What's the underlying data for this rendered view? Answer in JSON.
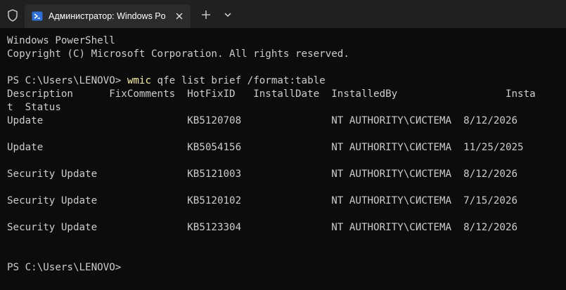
{
  "tab": {
    "title": "Администратор: Windows Po",
    "close_icon": "close-icon",
    "app_icon": "powershell-icon"
  },
  "toolbar": {
    "shield_icon": "shield-icon",
    "new_tab_icon": "plus-icon",
    "dropdown_icon": "chevron-down-icon"
  },
  "terminal": {
    "header_line1": "Windows PowerShell",
    "header_line2": "Copyright (C) Microsoft Corporation. All rights reserved.",
    "prompt": "PS C:\\Users\\LENOVO> ",
    "command_keyword": "wmic",
    "command_rest": " qfe list brief /format:table",
    "table_header_line1": "Description      FixComments  HotFixID   InstallDate  InstalledBy                  Insta",
    "table_header_line2": "t  Status",
    "rows": [
      "Update                        KB5120708               NT AUTHORITY\\СИСТЕМА  8/12/2026",
      "Update                        KB5054156               NT AUTHORITY\\СИСТЕМА  11/25/2025",
      "Security Update               KB5121003               NT AUTHORITY\\СИСТЕМА  8/12/2026",
      "Security Update               KB5120102               NT AUTHORITY\\СИСТЕМА  7/15/2026",
      "Security Update               KB5123304               NT AUTHORITY\\СИСТЕМА  8/12/2026"
    ],
    "final_prompt": "PS C:\\Users\\LENOVO>"
  },
  "colors": {
    "background": "#0c0c0c",
    "tabbar": "#202020",
    "tab_active": "#2b2b2b",
    "text": "#cccccc",
    "command_highlight": "#f9f1a5",
    "powershell_blue": "#2f6fd6"
  }
}
